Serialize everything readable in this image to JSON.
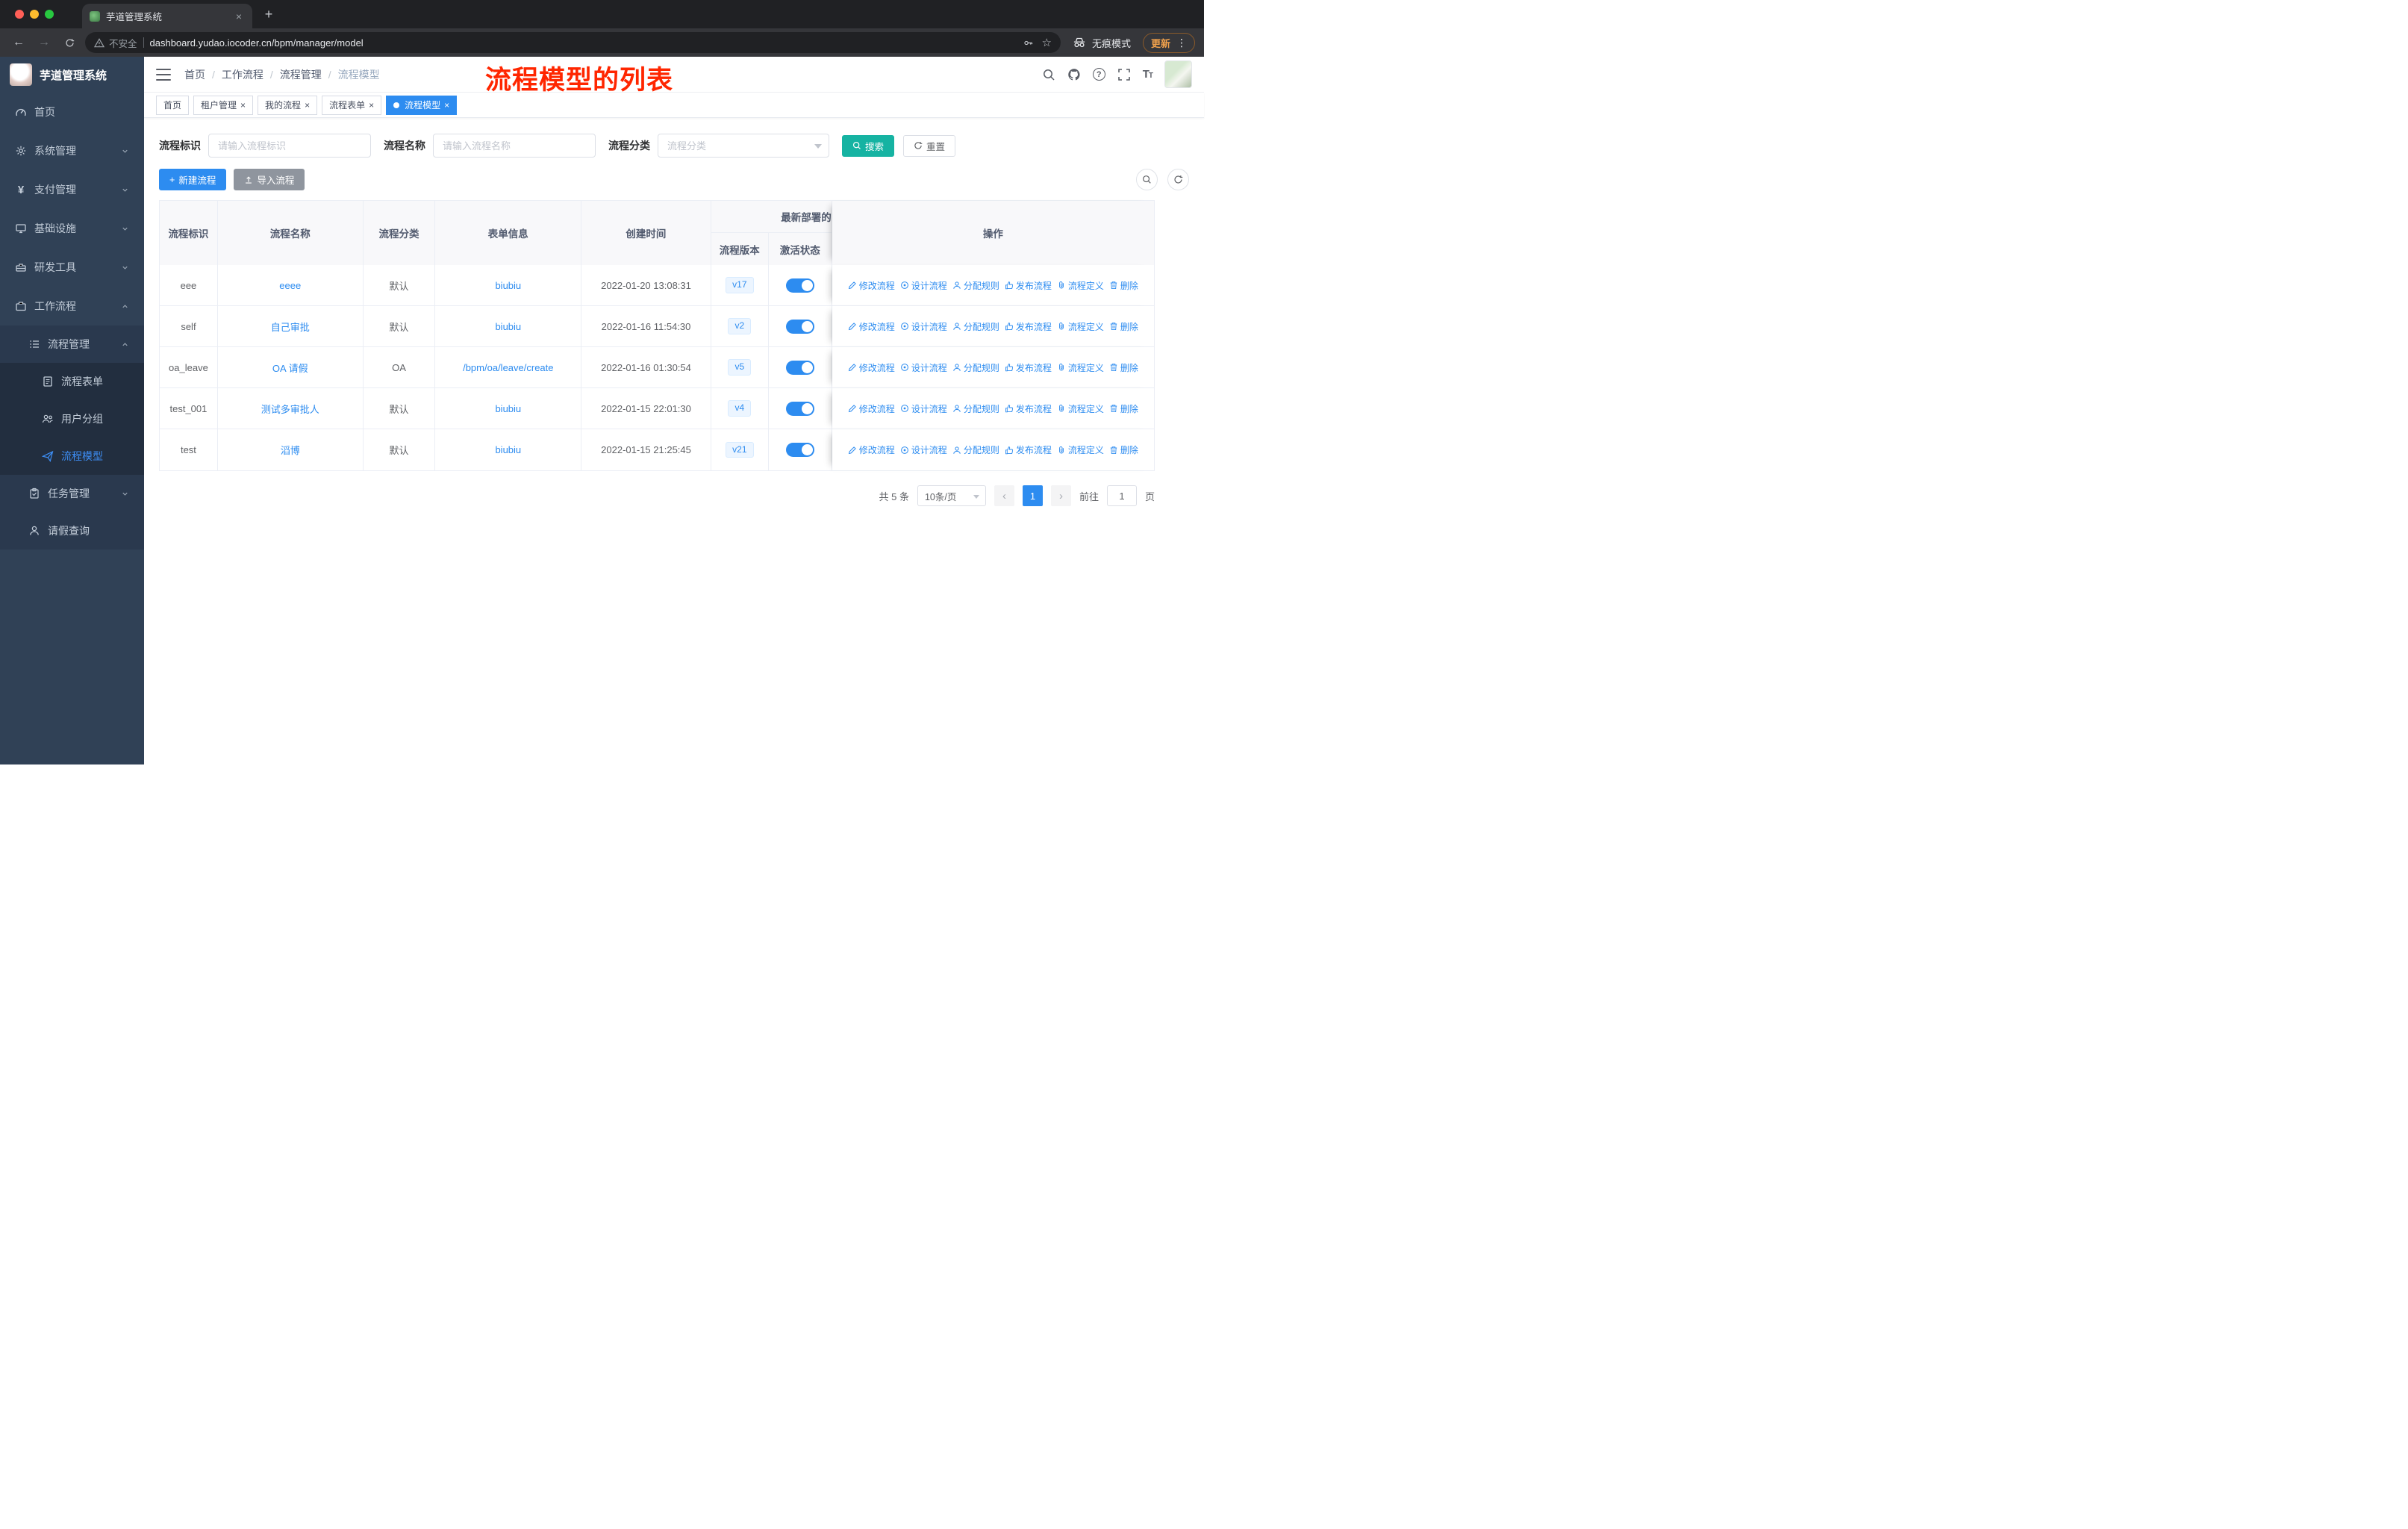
{
  "browser": {
    "tab_title": "芋道管理系统",
    "security_label": "不安全",
    "url": "dashboard.yudao.iocoder.cn/bpm/manager/model",
    "incognito_label": "无痕模式",
    "update_label": "更新"
  },
  "icons": {
    "back": "←",
    "forward": "→",
    "more": "⋮",
    "star": "☆",
    "close": "×",
    "plus": "+",
    "yen": "¥",
    "prev": "‹",
    "next": "›"
  },
  "annotation": "流程模型的列表",
  "sidebar": {
    "logo_text": "芋道管理系统",
    "items": [
      {
        "label": "首页"
      },
      {
        "label": "系统管理"
      },
      {
        "label": "支付管理"
      },
      {
        "label": "基础设施"
      },
      {
        "label": "研发工具"
      },
      {
        "label": "工作流程"
      },
      {
        "label": "流程管理"
      },
      {
        "label": "流程表单"
      },
      {
        "label": "用户分组"
      },
      {
        "label": "流程模型"
      },
      {
        "label": "任务管理"
      },
      {
        "label": "请假查询"
      }
    ]
  },
  "header": {
    "breadcrumb": [
      "首页",
      "工作流程",
      "流程管理",
      "流程模型"
    ],
    "separator": "/"
  },
  "tags": [
    {
      "label": "首页"
    },
    {
      "label": "租户管理"
    },
    {
      "label": "我的流程"
    },
    {
      "label": "流程表单"
    },
    {
      "label": "流程模型"
    }
  ],
  "filters": {
    "key_label": "流程标识",
    "key_placeholder": "请输入流程标识",
    "name_label": "流程名称",
    "name_placeholder": "请输入流程名称",
    "category_label": "流程分类",
    "category_placeholder": "流程分类",
    "search_label": "搜索",
    "reset_label": "重置"
  },
  "toolbar": {
    "create_label": "新建流程",
    "import_label": "导入流程"
  },
  "table": {
    "headers": {
      "id": "流程标识",
      "name": "流程名称",
      "category": "流程分类",
      "form": "表单信息",
      "created": "创建时间",
      "deploy_group": "最新部署的",
      "version": "流程版本",
      "state": "激活状态",
      "ops": "操作"
    },
    "ops": [
      "修改流程",
      "设计流程",
      "分配规则",
      "发布流程",
      "流程定义",
      "删除"
    ],
    "rows": [
      {
        "id": "eee",
        "name": "eeee",
        "category": "默认",
        "form": "biubiu",
        "created": "2022-01-20 13:08:31",
        "version": "v17",
        "active": true
      },
      {
        "id": "self",
        "name": "自己审批",
        "category": "默认",
        "form": "biubiu",
        "created": "2022-01-16 11:54:30",
        "version": "v2",
        "active": true
      },
      {
        "id": "oa_leave",
        "name": "OA 请假",
        "category": "OA",
        "form": "/bpm/oa/leave/create",
        "created": "2022-01-16 01:30:54",
        "version": "v5",
        "active": true
      },
      {
        "id": "test_001",
        "name": "测试多审批人",
        "category": "默认",
        "form": "biubiu",
        "created": "2022-01-15 22:01:30",
        "version": "v4",
        "active": true
      },
      {
        "id": "test",
        "name": "滔博",
        "category": "默认",
        "form": "biubiu",
        "created": "2022-01-15 21:25:45",
        "version": "v21",
        "active": true
      }
    ]
  },
  "pagination": {
    "total": "共 5 条",
    "page_size": "10条/页",
    "page": "1",
    "goto_prefix": "前往",
    "goto_suffix": "页",
    "goto_value": "1"
  },
  "colors": {
    "primary": "#2d8cf0",
    "search_button": "#16b3a2",
    "sidebar_bg": "#304156",
    "annotation_red": "#ff2600",
    "active_tag": "#2d8cf0"
  }
}
